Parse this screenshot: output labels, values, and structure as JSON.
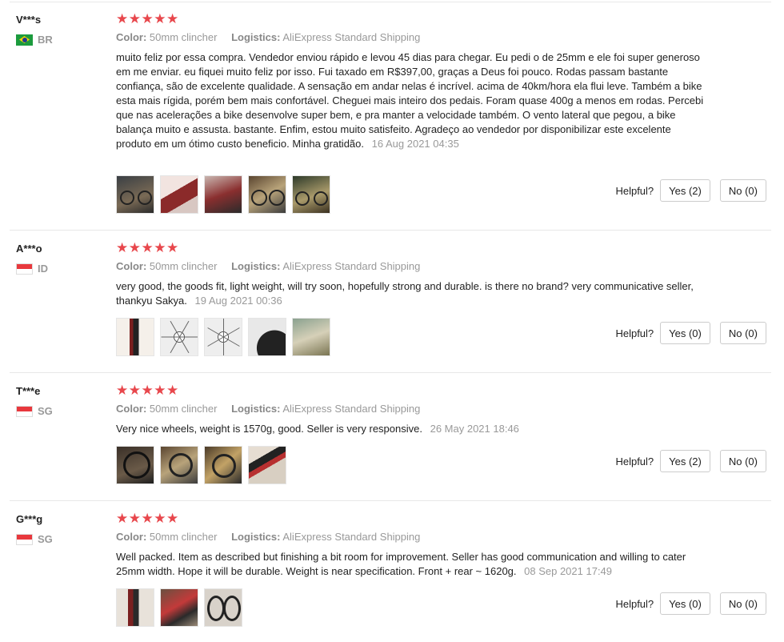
{
  "helpful_label": "Helpful?",
  "reviews": [
    {
      "user": "V***s",
      "country": "BR",
      "stars": "★★★★★",
      "color_label": "Color:",
      "color_value": "50mm clincher",
      "logistics_label": "Logistics:",
      "logistics_value": "AliExpress Standard Shipping",
      "text": "muito feliz por essa compra. Vendedor enviou rápido e levou 45 dias para chegar. Eu pedi o de 25mm e ele foi super generoso em me enviar. eu fiquei muito feliz por isso. Fui taxado em R$397,00, graças a Deus foi pouco. Rodas passam bastante confiança, são de excelente qualidade. A sensação em andar nelas é incrível. acima de 40km/hora ela flui leve. Também a bike esta mais rígida, porém bem mais confortável. Cheguei mais inteiro dos pedais. Foram quase 400g a menos em rodas. Percebi que nas acelerações a bike desenvolve super bem, e pra manter a velocidade também. O vento lateral que pegou, a bike balança muito e assusta. bastante. Enfim, estou muito satisfeito. Agradeço ao vendedor por disponibilizar este excelente produto em um ótimo custo beneficio. Minha gratidão.",
      "date": "16 Aug 2021 04:35",
      "yes": "Yes (2)",
      "no": "No (0)"
    },
    {
      "user": "A***o",
      "country": "ID",
      "stars": "★★★★★",
      "color_label": "Color:",
      "color_value": "50mm clincher",
      "logistics_label": "Logistics:",
      "logistics_value": "AliExpress Standard Shipping",
      "text": "very good, the goods fit, light weight, will try soon, hopefully strong and durable. is there no brand? very communicative seller, thankyu Sakya.",
      "date": "19 Aug 2021 00:36",
      "yes": "Yes (0)",
      "no": "No (0)"
    },
    {
      "user": "T***e",
      "country": "SG",
      "stars": "★★★★★",
      "color_label": "Color:",
      "color_value": "50mm clincher",
      "logistics_label": "Logistics:",
      "logistics_value": "AliExpress Standard Shipping",
      "text": "Very nice wheels, weight is 1570g, good. Seller is very responsive.",
      "date": "26 May 2021 18:46",
      "yes": "Yes (2)",
      "no": "No (0)"
    },
    {
      "user": "G***g",
      "country": "SG",
      "stars": "★★★★★",
      "color_label": "Color:",
      "color_value": "50mm clincher",
      "logistics_label": "Logistics:",
      "logistics_value": "AliExpress Standard Shipping",
      "text": "Well packed. Item as described but finishing a bit room for improvement. Seller has good communication and willing to cater 25mm width. Hope it will be durable. Weight is near specification. Front + rear ~ 1620g.",
      "date": "08 Sep 2021 17:49",
      "yes": "Yes (0)",
      "no": "No (0)"
    }
  ]
}
